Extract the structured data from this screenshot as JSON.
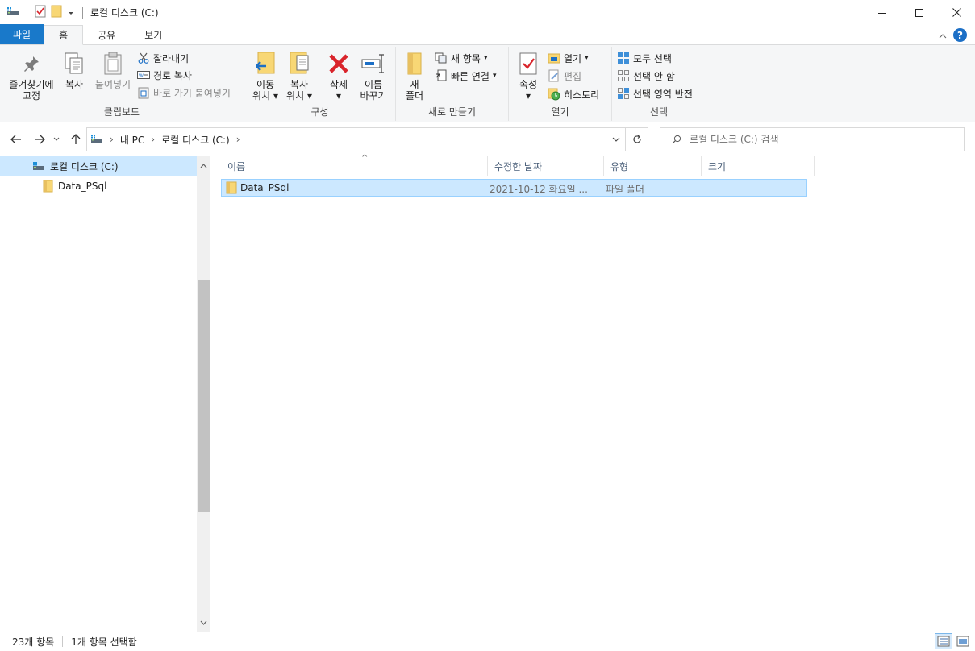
{
  "window": {
    "title": "로컬 디스크 (C:)",
    "minimize_icon": "minimize-icon",
    "maximize_icon": "maximize-icon",
    "close_icon": "close-icon"
  },
  "ribbon_tabs": [
    {
      "label": "파일"
    },
    {
      "label": "홈"
    },
    {
      "label": "공유"
    },
    {
      "label": "보기"
    }
  ],
  "ribbon": {
    "clipboard": {
      "label": "클립보드",
      "pin_line1": "즐겨찾기에",
      "pin_line2": "고정",
      "copy": "복사",
      "paste": "붙여넣기",
      "cut": "잘라내기",
      "copy_path": "경로 복사",
      "paste_shortcut": "바로 가기 붙여넣기"
    },
    "organize": {
      "label": "구성",
      "move_line1": "이동",
      "move_line2": "위치",
      "copyto_line1": "복사",
      "copyto_line2": "위치",
      "delete": "삭제",
      "rename_line1": "이름",
      "rename_line2": "바꾸기"
    },
    "new": {
      "label": "새로 만들기",
      "new_folder_line1": "새",
      "new_folder_line2": "폴더",
      "new_item": "새 항목",
      "easy_access": "빠른 연결"
    },
    "open": {
      "label": "열기",
      "properties": "속성",
      "open": "열기",
      "edit": "편집",
      "history": "히스토리"
    },
    "select": {
      "label": "선택",
      "select_all": "모두 선택",
      "select_none": "선택 안 함",
      "invert": "선택 영역 반전"
    }
  },
  "address_bar": {
    "crumbs": [
      "내 PC",
      "로컬 디스크 (C:)"
    ],
    "search_placeholder": "로컬 디스크 (C:) 검색"
  },
  "nav_pane": {
    "items": [
      {
        "label": "로컬 디스크 (C:)",
        "selected": true
      },
      {
        "label": "Data_PSql",
        "selected": false
      }
    ]
  },
  "file_list": {
    "columns": [
      "이름",
      "수정한 날짜",
      "유형",
      "크기"
    ],
    "rows": [
      {
        "name": "Data_PSql",
        "modified": "2021-10-12 화요일 ...",
        "type": "파일 폴더",
        "size": ""
      }
    ]
  },
  "status_bar": {
    "item_count": "23개 항목",
    "selection": "1개 항목 선택함"
  },
  "colors": {
    "file_tab": "#1979ca",
    "selection": "#cce8ff",
    "folder": "#f8d775",
    "delete_red": "#d9242b"
  }
}
